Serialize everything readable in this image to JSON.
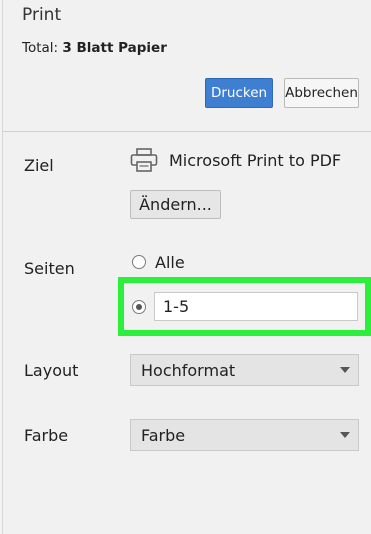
{
  "header": {
    "title": "Print",
    "total_label": "Total:",
    "total_value": "3 Blatt Papier",
    "print_button": "Drucken",
    "cancel_button": "Abbrechen"
  },
  "destination": {
    "label": "Ziel",
    "printer_icon": "printer-icon",
    "printer_name": "Microsoft Print to PDF",
    "change_button": "Ändern..."
  },
  "pages": {
    "label": "Seiten",
    "option_all": "Alle",
    "custom_value": "1-5",
    "selected": "custom"
  },
  "layout": {
    "label": "Layout",
    "value": "Hochformat"
  },
  "color": {
    "label": "Farbe",
    "value": "Farbe"
  },
  "colors": {
    "accent": "#3f7fd1",
    "highlight": "#2bef3a"
  }
}
